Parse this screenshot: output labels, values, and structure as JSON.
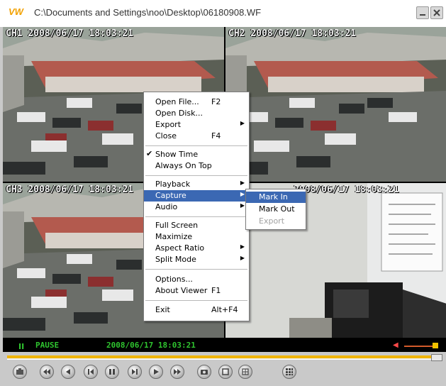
{
  "window": {
    "title": "C:\\Documents and Settings\\noo\\Desktop\\06180908.WF",
    "logo_icon": "vw-logo-icon",
    "min_icon": "minimize-icon",
    "close_icon": "close-icon"
  },
  "cameras": [
    {
      "id": "ch1",
      "osd": "CH1 2008/06/17 18:03:21"
    },
    {
      "id": "ch2",
      "osd": "CH2 2008/06/17 18:03:21"
    },
    {
      "id": "ch3",
      "osd": "CH3 2008/06/17 18:03:21"
    },
    {
      "id": "ch4",
      "osd": "2008/06/17 18:03:21"
    }
  ],
  "context_menu": {
    "items": [
      {
        "label": "Open File...",
        "shortcut": "F2"
      },
      {
        "label": "Open Disk...",
        "shortcut": ""
      },
      {
        "label": "Export",
        "shortcut": "",
        "submenu": true
      },
      {
        "label": "Close",
        "shortcut": "F4"
      },
      {
        "label": "Show Time",
        "checked": true
      },
      {
        "label": "Always On Top"
      },
      {
        "label": "Playback",
        "submenu": true
      },
      {
        "label": "Capture",
        "submenu": true,
        "highlighted": true
      },
      {
        "label": "Audio",
        "submenu": true
      },
      {
        "label": "Full Screen"
      },
      {
        "label": "Maximize"
      },
      {
        "label": "Aspect Ratio",
        "submenu": true
      },
      {
        "label": "Split Mode",
        "submenu": true
      },
      {
        "label": "Options..."
      },
      {
        "label": "About Viewer",
        "shortcut": "F1"
      },
      {
        "label": "Exit",
        "shortcut": "Alt+F4"
      }
    ],
    "check_mark": "✔",
    "submenu_arrow": "▶"
  },
  "capture_submenu": {
    "items": [
      {
        "label": "Mark In",
        "highlighted": true
      },
      {
        "label": "Mark Out"
      },
      {
        "label": "Export",
        "disabled": true
      }
    ]
  },
  "status": {
    "pause_symbol": "II",
    "state": "PAUSE",
    "time": "2008/06/17 18:03:21",
    "volume_icon": "speaker-icon"
  },
  "progress": {
    "fraction": 1.0
  },
  "controls": [
    "snapshot-icon",
    "first-frame-icon",
    "rewind-icon",
    "step-back-icon",
    "pause-icon",
    "step-forward-icon",
    "play-icon",
    "fast-forward-icon",
    "camera-icon",
    "single-view-icon",
    "quad-view-icon",
    "grid-view-icon"
  ],
  "colors": {
    "menu_highlight": "#3b68b3",
    "status_green": "#2fc42f",
    "progress": "#f0b400"
  }
}
